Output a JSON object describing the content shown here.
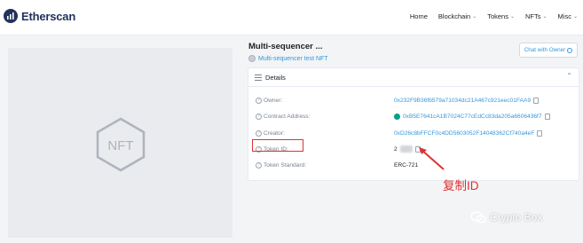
{
  "brand": {
    "name": "Etherscan"
  },
  "nav": {
    "items": [
      {
        "label": "Home",
        "has_caret": false
      },
      {
        "label": "Blockchain",
        "has_caret": true
      },
      {
        "label": "Tokens",
        "has_caret": true
      },
      {
        "label": "NFTs",
        "has_caret": true
      },
      {
        "label": "Misc",
        "has_caret": true
      }
    ]
  },
  "nft": {
    "title": "Multi-sequencer ...",
    "collection": "Multi-sequencer test NFT",
    "image_text": "NFT"
  },
  "chat_button": {
    "label": "Chat with Owner"
  },
  "details": {
    "header": "Details",
    "rows": [
      {
        "label": "Owner:",
        "value": "0x232F9B36fb579a71034dc21A467c921eec01FAA9"
      },
      {
        "label": "Contract Address:",
        "value": "0xB5E7641cA1B7024C77cEdCc83da205a6606436f7"
      },
      {
        "label": "Creator:",
        "value": "0xD26c8bFFCF0c4DD5603052F14048362Cf740a4eF"
      },
      {
        "label": "Token ID:",
        "value": "2"
      },
      {
        "label": "Token Standard:",
        "value": "ERC-721"
      }
    ]
  },
  "annotation": {
    "text": "复制ID",
    "color": "#e03131"
  },
  "watermark": {
    "text": "Crypto Box"
  },
  "colors": {
    "link": "#3498db",
    "brand": "#21325b",
    "verified": "#00a186"
  }
}
